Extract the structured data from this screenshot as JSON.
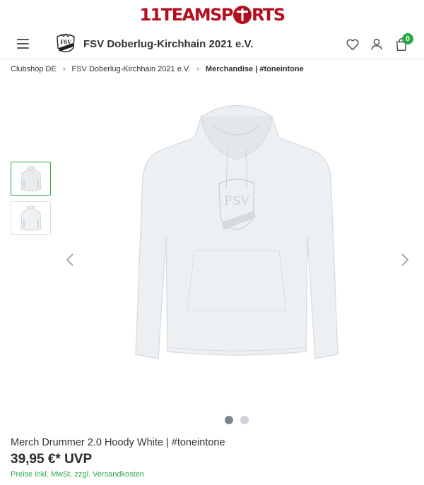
{
  "brand": {
    "logo_left": "11TEAMSP",
    "logo_right": "RTS",
    "color": "#b11020"
  },
  "header": {
    "club_name": "FSV Doberlug-Kirchhain 2021 e.V.",
    "cart_count": "0",
    "icons": [
      "menu-icon",
      "club-logo",
      "heart-icon",
      "user-icon",
      "shopping-bag-icon"
    ]
  },
  "breadcrumb": [
    {
      "label": "Clubshop DE"
    },
    {
      "label": "FSV Doberlug-Kirchhain 2021 e.V."
    },
    {
      "label": "Merchandise | #toneintone"
    }
  ],
  "gallery": {
    "image_count": 2,
    "active_index": 0
  },
  "product": {
    "title": "Merch Drummer 2.0 Hoody White | #toneintone",
    "price": "39,95 €* UVP",
    "tax_prefix": "Preise inkl. MwSt. zzgl.",
    "shipping_link": "Versandkosten"
  },
  "colors": {
    "accent_green": "#2aa84a",
    "text": "#333333",
    "dot_active": "#7a8793",
    "dot_inactive": "#cfd3d8"
  }
}
